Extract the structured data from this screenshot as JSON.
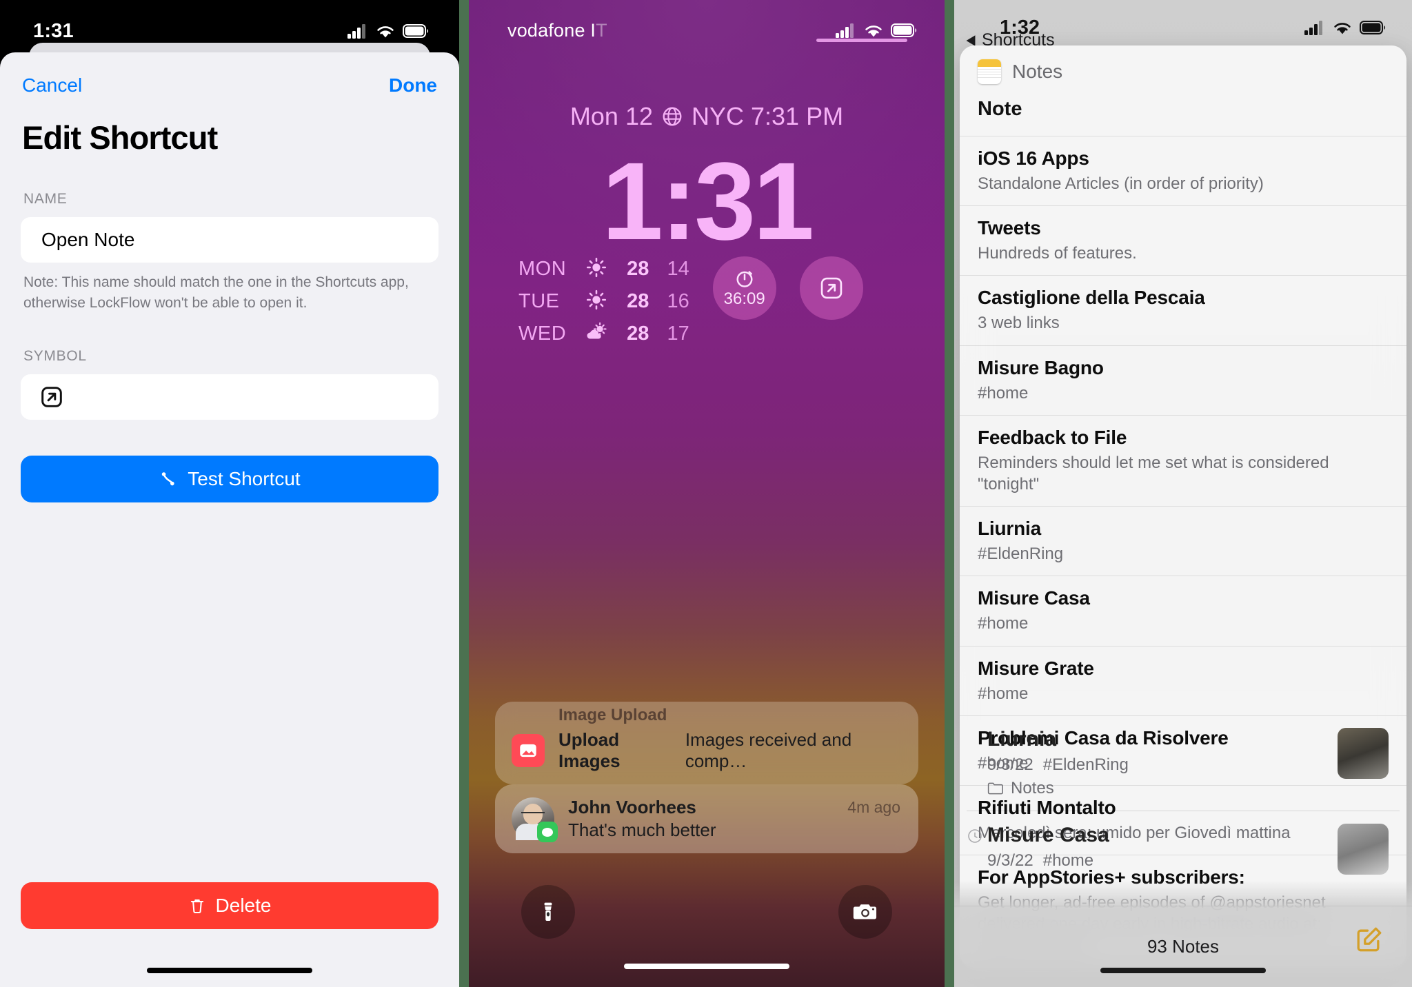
{
  "left_panel": {
    "status_bar": {
      "time": "1:31",
      "icons": [
        "cellular-icon",
        "wifi-icon",
        "battery-icon"
      ]
    },
    "sheet": {
      "cancel_label": "Cancel",
      "done_label": "Done",
      "title": "Edit Shortcut",
      "name_section_label": "NAME",
      "name_value": "Open Note",
      "name_hint": "Note: This name should match the one in the Shortcuts app, otherwise LockFlow won't be able to open it.",
      "symbol_section_label": "SYMBOL",
      "symbol_icon": "arrow-up-right-square-icon",
      "test_button_label": "Test Shortcut",
      "test_button_icon": "shortcut-link-icon",
      "delete_button_label": "Delete",
      "delete_button_icon": "trash-icon"
    },
    "colors": {
      "accent": "#007aff",
      "danger": "#ff3b30",
      "sheet_bg": "#f1f1f5"
    }
  },
  "middle_panel": {
    "status_bar": {
      "carrier": "vodafone I",
      "carrier_faded": "T",
      "icons": [
        "cellular-icon",
        "wifi-icon",
        "battery-icon"
      ]
    },
    "lock_screen": {
      "date_text": "Mon 12",
      "city_icon": "globe-icon",
      "city_time": "NYC 7:31 PM",
      "clock": "1:31",
      "weather_widget": {
        "rows": [
          {
            "day": "MON",
            "icon": "sun-icon",
            "high": "28",
            "low": "14"
          },
          {
            "day": "TUE",
            "icon": "sun-icon",
            "high": "28",
            "low": "16"
          },
          {
            "day": "WED",
            "icon": "partly-cloudy-icon",
            "high": "28",
            "low": "17"
          }
        ]
      },
      "timer_widget": {
        "icon": "timer-icon",
        "value": "36:09"
      },
      "shortcut_widget": {
        "icon": "arrow-up-right-square-icon"
      },
      "notifications": [
        {
          "sender": "John Voorhees",
          "message": "That's much better",
          "time": "4m ago",
          "app_badge": "messages-icon"
        },
        {
          "app_title": "Image Upload",
          "title": "Upload Images",
          "message": "Images received and comp…",
          "icon": "photo-upload-icon"
        }
      ],
      "controls": [
        {
          "name": "flashlight",
          "icon": "flashlight-icon"
        },
        {
          "name": "camera",
          "icon": "camera-icon"
        }
      ]
    }
  },
  "right_panel": {
    "status_bar": {
      "time": "1:32",
      "icons": [
        "cellular-icon",
        "wifi-icon",
        "battery-icon"
      ]
    },
    "back_link": {
      "label": "Shortcuts",
      "icon": "back-triangle-icon"
    },
    "popover": {
      "app_name": "Notes",
      "app_icon": "notes-app-icon",
      "section_label": "Note",
      "notes": [
        {
          "title": "iOS 16 Apps",
          "subtitle": "Standalone Articles (in order of priority)"
        },
        {
          "title": "Tweets",
          "subtitle": "Hundreds of features."
        },
        {
          "title": "Castiglione della Pescaia",
          "subtitle": "3 web links"
        },
        {
          "title": "Misure Bagno",
          "subtitle": "#home"
        },
        {
          "title": "Feedback to File",
          "subtitle": "Reminders should let me set what is considered \"tonight\""
        },
        {
          "title": "Liurnia",
          "subtitle": "#EldenRing"
        },
        {
          "title": "Misure Casa",
          "subtitle": "#home"
        },
        {
          "title": "Misure Grate",
          "subtitle": "#home"
        },
        {
          "title": "Problemi Casa da Risolvere",
          "subtitle": "#home"
        },
        {
          "title": "Rifiuti Montalto",
          "subtitle": "Mercoledì sera: umido per Giovedì mattina"
        },
        {
          "title": "For AppStories+ subscribers:",
          "subtitle": "Get longer, ad-free episodes of @appstoriesnet delivered one day early in high-bitrate audio at: appstories.plus"
        }
      ]
    },
    "notes_list": [
      {
        "title": "Liurnia",
        "date": "9/3/22",
        "tag": "#EldenRing",
        "folder": "Notes",
        "pinned": false
      },
      {
        "title": "Misure Casa",
        "date": "9/3/22",
        "tag": "#home",
        "folder": "",
        "pinned": true
      }
    ],
    "toolbar": {
      "count_label": "93 Notes",
      "compose_icon": "compose-icon"
    },
    "colors": {
      "notes_accent": "#d4a02a"
    }
  }
}
